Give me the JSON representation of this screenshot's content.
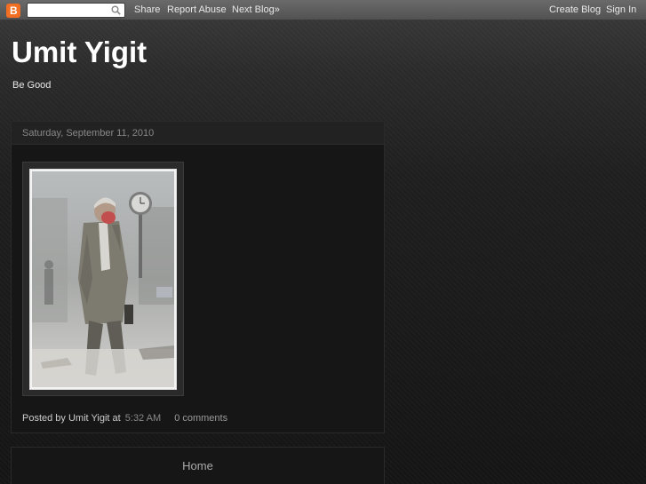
{
  "navbar": {
    "logo_letter": "B",
    "search_placeholder": "",
    "share": "Share",
    "report_abuse": "Report Abuse",
    "next_blog": "Next Blog»",
    "create_blog": "Create Blog",
    "sign_in": "Sign In"
  },
  "header": {
    "title": "Umit Yigit",
    "description": "Be Good"
  },
  "post": {
    "date": "Saturday, September 11, 2010",
    "posted_by_prefix": "Posted by",
    "author": "Umit Yigit",
    "at": "at",
    "time": "5:32 AM",
    "comments": "0 comments"
  },
  "footer": {
    "home": "Home"
  },
  "colors": {
    "accent": "#f26e22",
    "background": "#1c1c1c",
    "post_bg": "#161616",
    "title": "#ffffff"
  }
}
